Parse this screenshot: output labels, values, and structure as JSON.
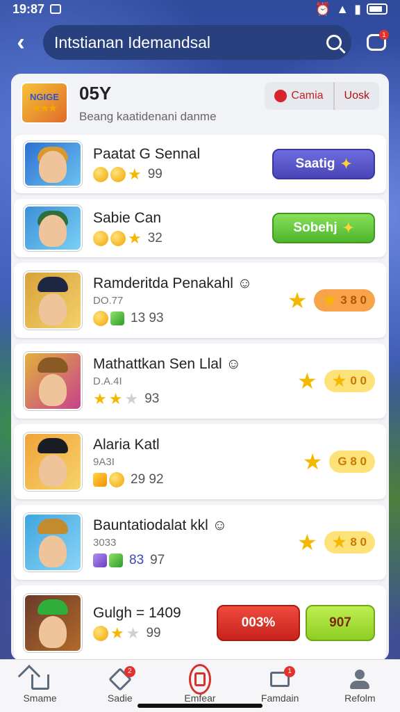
{
  "status": {
    "time": "19:87"
  },
  "topbar": {
    "search_value": "Intstianan Idemandsal",
    "chat_badge": "1"
  },
  "panel": {
    "logo_text": "NGIGE",
    "title": "05Y",
    "subtitle": "Beang kaatidenani danme",
    "tab_games": "Camia",
    "tab_user": "Uosk"
  },
  "rows": [
    {
      "name": "Paatat G Sennal",
      "sub": "",
      "count": "99",
      "button": "Saatig"
    },
    {
      "name": "Sabie Can",
      "sub": "",
      "count": "32",
      "button": "Sobehj"
    },
    {
      "name": "Ramderitda Penakahl",
      "sub": "DO.77",
      "count": "13 93",
      "rating": "3 8 0"
    },
    {
      "name": "Mathattkan Sen Llal",
      "sub": "D.A.4I",
      "count": "93",
      "rating": "0 0"
    },
    {
      "name": "Alaria Katl",
      "sub": "9A3I",
      "count": "29 92",
      "rating": "G 8 0"
    },
    {
      "name": "Bauntatiodalat kkl",
      "sub": "3033",
      "count_primary": "83",
      "count": "97",
      "rating": "8 0"
    },
    {
      "name": "Gulgh = 1409",
      "sub": "",
      "count": "99",
      "red_button": "003%",
      "lime_button": "907"
    }
  ],
  "nav": {
    "items": [
      {
        "label": "Smame",
        "badge": ""
      },
      {
        "label": "Sadie",
        "badge": "2"
      },
      {
        "label": "Emfear",
        "badge": ""
      },
      {
        "label": "Famdain",
        "badge": "1"
      },
      {
        "label": "Refolm",
        "badge": ""
      }
    ]
  },
  "colors": {
    "accent_purple": "#4a45b6",
    "accent_green": "#4fb52c",
    "accent_red": "#d9302a",
    "header_blue": "#28407e"
  }
}
